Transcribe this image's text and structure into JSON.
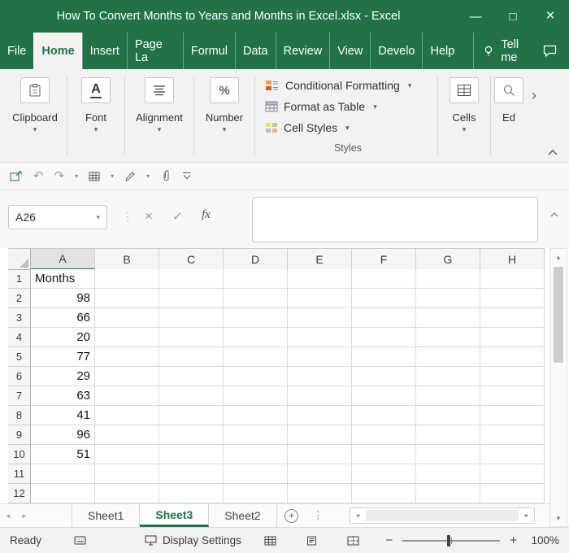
{
  "window": {
    "title": "How To Convert Months to Years and Months in Excel.xlsx  -  Excel",
    "controls": {
      "minimize": "—",
      "maximize": "□",
      "close": "×"
    }
  },
  "menu": {
    "items": [
      "File",
      "Home",
      "Insert",
      "Page La",
      "Formul",
      "Data",
      "Review",
      "View",
      "Develo",
      "Help"
    ],
    "active_item": "Home",
    "tell_me_label": "Tell me"
  },
  "ribbon": {
    "groups": [
      {
        "label": "Clipboard"
      },
      {
        "label": "Font"
      },
      {
        "label": "Alignment"
      },
      {
        "label": "Number"
      }
    ],
    "styles_group": {
      "buttons": [
        "Conditional Formatting",
        "Format as Table",
        "Cell Styles"
      ],
      "caption": "Styles"
    },
    "cells_group_label": "Cells",
    "editing_group_label": "Ed",
    "font_group_glyph": "A",
    "number_group_glyph": "%"
  },
  "formula_bar": {
    "name_box_value": "A26",
    "fx_label": "fx",
    "formula_value": ""
  },
  "grid": {
    "columns": [
      "A",
      "B",
      "C",
      "D",
      "E",
      "F",
      "G",
      "H"
    ],
    "rows": [
      "1",
      "2",
      "3",
      "4",
      "5",
      "6",
      "7",
      "8",
      "9",
      "10",
      "11",
      "12"
    ],
    "selected_column": "A",
    "cells": {
      "A1": "Months",
      "A2": "98",
      "A3": "66",
      "A4": "20",
      "A5": "77",
      "A6": "29",
      "A7": "63",
      "A8": "41",
      "A9": "96",
      "A10": "51"
    }
  },
  "sheets": {
    "tabs": [
      "Sheet1",
      "Sheet3",
      "Sheet2"
    ],
    "active_tab": "Sheet3"
  },
  "status_bar": {
    "mode": "Ready",
    "display_settings_label": "Display Settings",
    "zoom_level": "100%"
  },
  "icons": {
    "dropdown": "▾",
    "overflow": "›",
    "undo": "↶",
    "redo": "↷",
    "separator_dots": "⋮",
    "cancel": "×",
    "check": "✓",
    "scroll_up": "▲",
    "scroll_down": "▼",
    "scroll_left": "◄",
    "scroll_right": "►",
    "tab_nav_left": "◄",
    "tab_nav_right": "►",
    "add_sheet": "+",
    "zoom_out": "−",
    "zoom_in": "+"
  },
  "colors": {
    "excel_green": "#217346",
    "ribbon_background": "#f3f2f1",
    "grid_line": "#d9d9d9",
    "header_background": "#f5f5f5"
  }
}
